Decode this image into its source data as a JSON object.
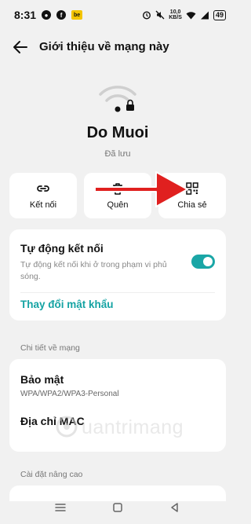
{
  "status_bar": {
    "time": "8:31",
    "speed_value": "10,0",
    "speed_unit": "KB/S",
    "battery": "49"
  },
  "header": {
    "title": "Giới thiệu về mạng này"
  },
  "network": {
    "name": "Do Muoi",
    "status": "Đã lưu"
  },
  "actions": [
    {
      "label": "Kết nối",
      "icon": "link-icon"
    },
    {
      "label": "Quên",
      "icon": "trash-icon"
    },
    {
      "label": "Chia sẻ",
      "icon": "qr-code-icon"
    }
  ],
  "auto_connect": {
    "title": "Tự động kết nối",
    "description": "Tự động kết nối khi ở trong phạm vi phủ sóng.",
    "enabled": true
  },
  "change_password": "Thay đổi mật khẩu",
  "details_section": {
    "label": "Chi tiết về mạng",
    "security_title": "Bảo mật",
    "security_value": "WPA/WPA2/WPA3-Personal",
    "mac_title": "Địa chỉ MAC"
  },
  "advanced_section": {
    "label": "Cài đặt nâng cao"
  },
  "watermark": "uantrimang",
  "colors": {
    "accent": "#1aa6a6",
    "link": "#15a3a3",
    "arrow": "#e0201f",
    "background": "#f1f1f1"
  }
}
